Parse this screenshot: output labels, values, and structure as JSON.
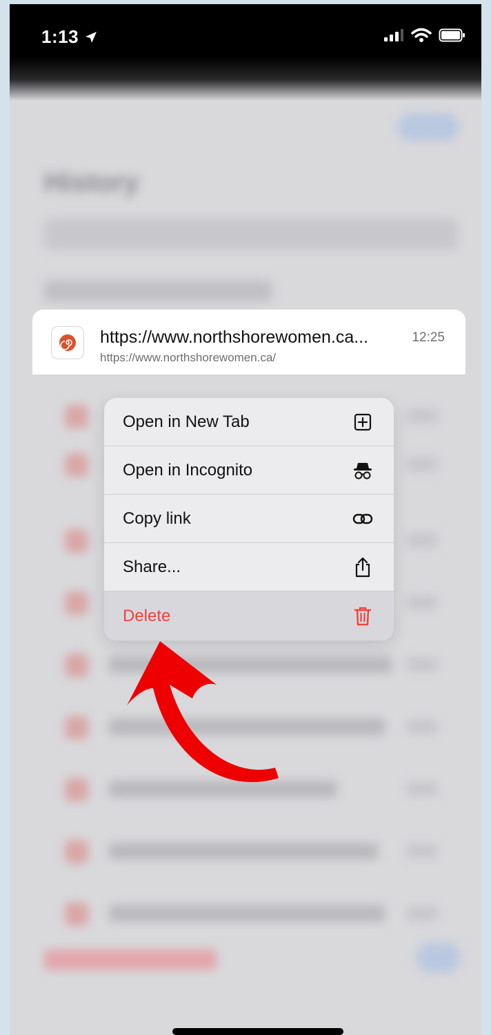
{
  "status_bar": {
    "time": "1:13"
  },
  "background": {
    "title": "History"
  },
  "preview": {
    "title": "https://www.northshorewomen.ca...",
    "url": "https://www.northshorewomen.ca/",
    "time": "12:25",
    "favicon": "spiral-favicon"
  },
  "menu": {
    "items": [
      {
        "label": "Open in New Tab",
        "icon": "plus-square-icon"
      },
      {
        "label": "Open in Incognito",
        "icon": "incognito-icon"
      },
      {
        "label": "Copy link",
        "icon": "link-icon"
      },
      {
        "label": "Share...",
        "icon": "share-icon"
      },
      {
        "label": "Delete",
        "icon": "trash-icon",
        "color": "#f0423c"
      }
    ]
  },
  "annotation": {
    "arrow_color": "#ee0000"
  }
}
